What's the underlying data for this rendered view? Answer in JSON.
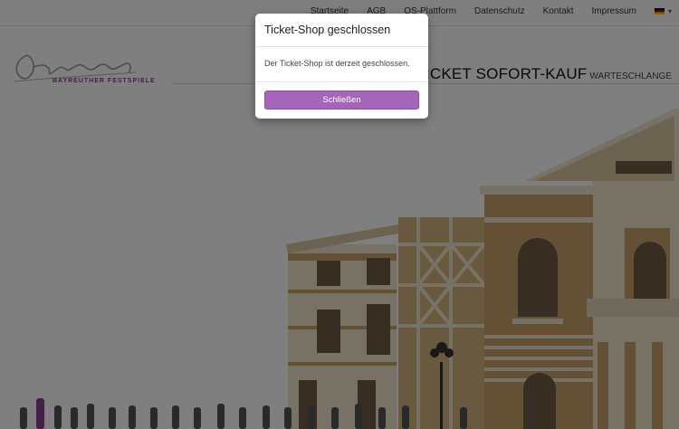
{
  "nav": {
    "items": [
      "Startseite",
      "AGB",
      "OS-Plattform",
      "Datenschutz",
      "Kontakt",
      "Impressum"
    ],
    "language_caret": "▾"
  },
  "logo": {
    "subtitle": "BAYREUTHER FESTSPIELE"
  },
  "headline": {
    "main": "TICKET SOFORT-KAUF",
    "secondary": "WARTESCHLANGE"
  },
  "modal": {
    "title": "Ticket-Shop geschlossen",
    "message": "Der Ticket-Shop ist derzeit geschlossen.",
    "close_label": "Schließen"
  },
  "colors": {
    "accent": "#a466b8",
    "building_brown": "#c9a36a",
    "building_cream": "#efe3cc",
    "overlay": "rgba(0,0,0,0.5)"
  }
}
